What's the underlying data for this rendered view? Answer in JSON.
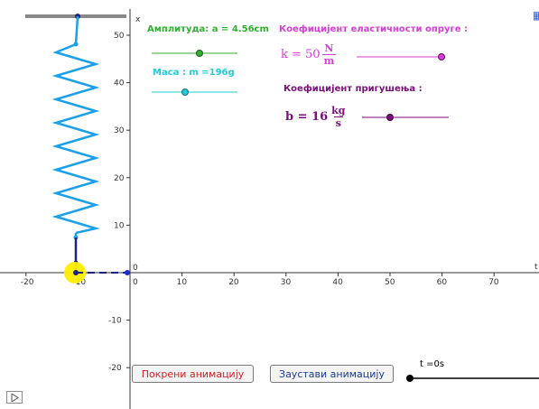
{
  "labels": {
    "amplitude": "Амплитуда: a = 4.56cm",
    "mass": "Маса : m =196g",
    "spring_coef_title": "Коефицијент еластичности опруге :",
    "damping_coef_title": "Коефицијент пригушења :"
  },
  "k_expr": {
    "prefix": "k = 50",
    "num": "N",
    "den": "m"
  },
  "b_expr": {
    "prefix": "b = 16",
    "num": "kg",
    "den": "s"
  },
  "buttons": {
    "start": "Покрени анимацију",
    "stop": "Заустави анимацију"
  },
  "time_label": "t =0s",
  "axes": {
    "x_ticks": [
      "-20",
      "-10",
      "0",
      "10",
      "20",
      "30",
      "40",
      "50",
      "60",
      "70"
    ],
    "y_ticks": [
      "50",
      "40",
      "30",
      "20",
      "10",
      "0",
      "-10",
      "-20"
    ],
    "x_axis_label": "t",
    "y_axis_label": "x"
  },
  "sliders": {
    "amplitude_value": 4.56,
    "mass_value": 196,
    "k_value": 50,
    "b_value": 16
  },
  "colors": {
    "green": "#2fb12f",
    "cyan": "#22cbd8",
    "magenta": "#d63cd6",
    "purple": "#7a0e7a",
    "spring": "#1aa0e8",
    "rod": "#1a237e",
    "yellow": "#ffee00"
  },
  "icons": {
    "play": "play-icon",
    "corner": "graphics-view-icon"
  }
}
